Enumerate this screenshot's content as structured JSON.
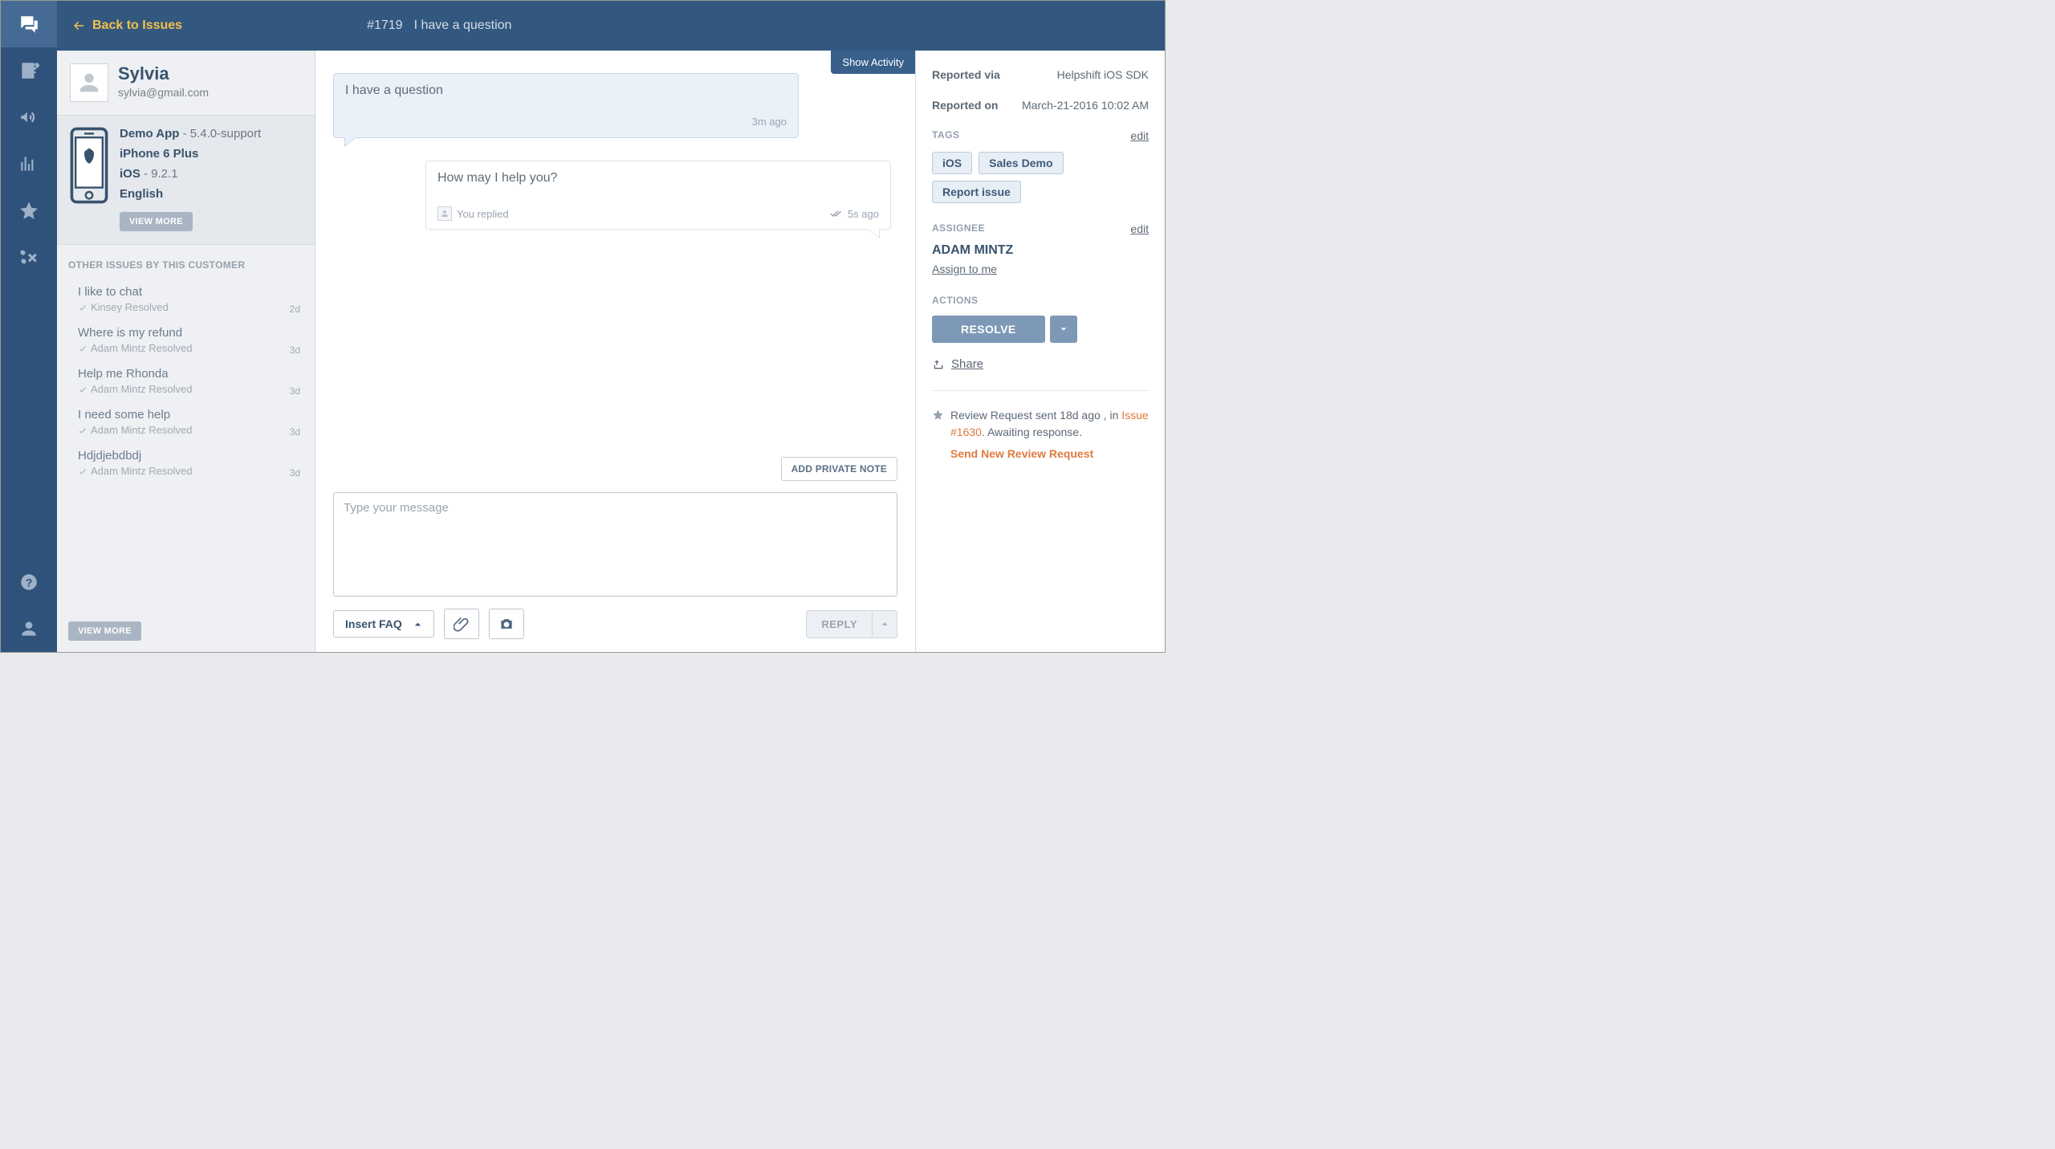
{
  "titlebar": {
    "back_label": "Back to Issues",
    "issue_id": "#1719",
    "issue_title": "I have a question"
  },
  "customer": {
    "name": "Sylvia",
    "email": "sylvia@gmail.com",
    "device": {
      "app_name": "Demo App",
      "app_version": " - 5.4.0-support",
      "model": "iPhone 6 Plus",
      "os_name": "iOS",
      "os_version": " - 9.2.1",
      "language": "English"
    },
    "view_more_label": "VIEW MORE",
    "other_issues_header": "OTHER ISSUES BY THIS CUSTOMER",
    "other_issues": [
      {
        "title": "I like to chat",
        "status": "Kinsey Resolved",
        "time": "2d"
      },
      {
        "title": "Where is my refund",
        "status": "Adam Mintz Resolved",
        "time": "3d"
      },
      {
        "title": "Help me Rhonda",
        "status": "Adam Mintz Resolved",
        "time": "3d"
      },
      {
        "title": "I need some help",
        "status": "Adam Mintz Resolved",
        "time": "3d"
      },
      {
        "title": "Hdjdjebdbdj",
        "status": "Adam Mintz Resolved",
        "time": "3d"
      }
    ],
    "view_more_footer": "VIEW MORE"
  },
  "conversation": {
    "show_activity_label": "Show Activity",
    "inbound": {
      "text": "I have a question",
      "time": "3m ago"
    },
    "outbound": {
      "text": "How may I help you?",
      "replier": "You replied",
      "time": "5s ago"
    },
    "add_note_label": "ADD PRIVATE NOTE",
    "composer_placeholder": "Type your message",
    "insert_faq_label": "Insert FAQ",
    "reply_label": "REPLY"
  },
  "details": {
    "reported_via_label": "Reported via",
    "reported_via_value": "Helpshift iOS SDK",
    "reported_on_label": "Reported on",
    "reported_on_value": "March-21-2016 10:02 AM",
    "tags_label": "TAGS",
    "edit_label": "edit",
    "tags": [
      "iOS",
      "Sales Demo",
      "Report issue"
    ],
    "assignee_label": "ASSIGNEE",
    "assignee_name": "ADAM MINTZ",
    "assign_to_me": "Assign to me",
    "actions_label": "ACTIONS",
    "resolve_label": "RESOLVE",
    "share_label": "Share",
    "review_prefix": "Review Request sent 18d ago , in ",
    "review_issue": "Issue #1630",
    "review_suffix": ". Awaiting response.",
    "send_new_review": "Send New Review Request"
  }
}
